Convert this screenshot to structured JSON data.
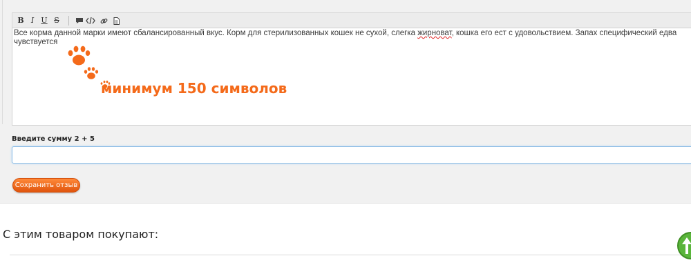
{
  "toolbar": {
    "bold_label": "B",
    "italic_label": "I",
    "underline_label": "U",
    "strike_label": "S"
  },
  "editor": {
    "text_before": "Все корма данной марки имеют сбалансированный вкус. Корм для стерилизованных кошек не сухой, слегка ",
    "misspelled_word": "жирноват",
    "text_after": ", кошка его ест с удовольствием. Запах специфический едва чувствуется",
    "min_length_hint": "минимум 150 символов"
  },
  "captcha": {
    "label": "Введите сумму 2 + 5",
    "value": ""
  },
  "submit": {
    "label": "Сохранить отзыв"
  },
  "related": {
    "title": "С этим товаром покупают:"
  },
  "colors": {
    "accent": "#f46a1a",
    "button": "#e8601a",
    "focus_border": "#8cbde6",
    "scroll_button": "#5ab53b"
  },
  "icons": [
    "comment-icon",
    "code-icon",
    "link-icon",
    "document-icon",
    "paw-print-icon",
    "scroll-top-icon"
  ]
}
